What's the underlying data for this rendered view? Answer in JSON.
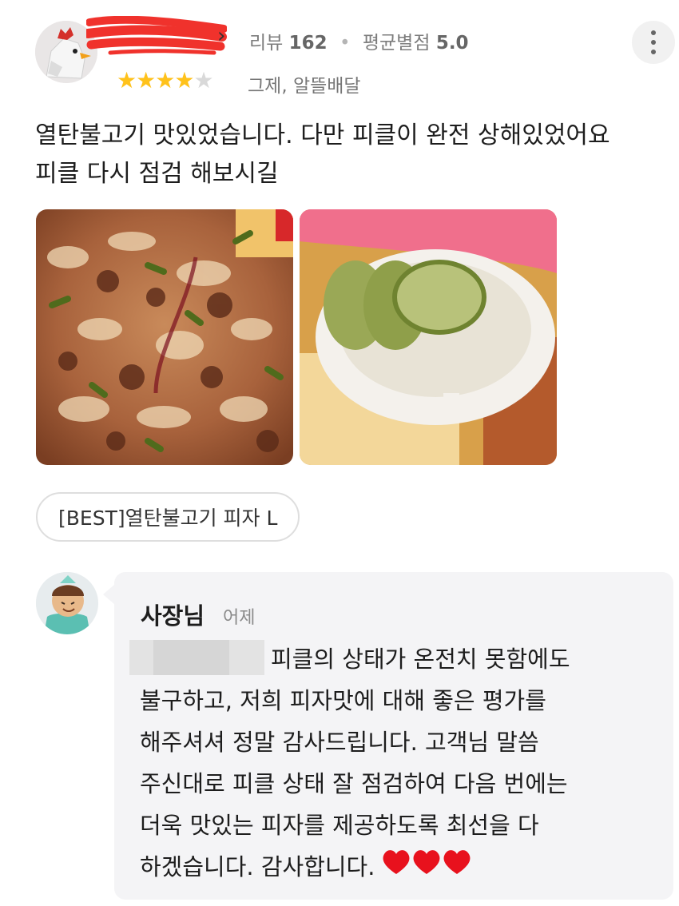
{
  "review": {
    "meta": {
      "review_label": "리뷰",
      "review_count": "162",
      "avg_label": "평균별점",
      "avg_value": "5.0"
    },
    "rating": 4,
    "rating_max": 5,
    "tags": "그제, 알뜰배달",
    "text_line1": "열탄불고기 맛있었습니다. 다만 피클이 완전 상해있었어요",
    "text_line2": "피클 다시 점검 해보시길",
    "menu_chip": "[BEST]열탄불고기 피자 L"
  },
  "reply": {
    "author": "사장님",
    "time": "어제",
    "line1": "피클의 상태가 온전치 못함에도",
    "line2": "불구하고, 저희 피자맛에 대해 좋은 평가를",
    "line3": "해주셔셔 정말 감사드립니다. 고객님 말씀",
    "line4": "주신대로  피클 상태 잘 점검하여 다음 번에는",
    "line5": "더욱 맛있는 피자를 제공하도록 최선을 다",
    "line6": "하겠습니다. 감사합니다."
  },
  "colors": {
    "star": "#ffc21b",
    "heart": "#e8111d",
    "bubble": "#f4f4f6"
  },
  "icons": {
    "more": "more-vertical-icon",
    "chevron": "chevron-right-icon",
    "heart": "heart-icon"
  }
}
